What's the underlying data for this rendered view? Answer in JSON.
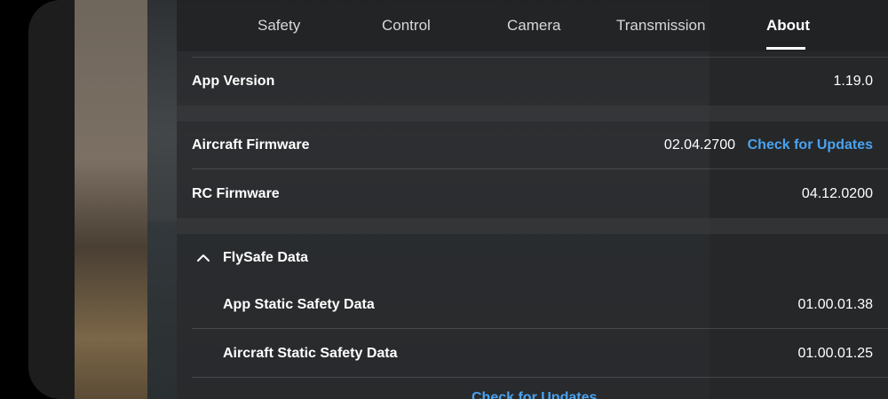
{
  "tabs": [
    {
      "label": "Safety",
      "active": false
    },
    {
      "label": "Control",
      "active": false
    },
    {
      "label": "Camera",
      "active": false
    },
    {
      "label": "Transmission",
      "active": false
    },
    {
      "label": "About",
      "active": true
    }
  ],
  "about": {
    "app_version": {
      "label": "App Version",
      "value": "1.19.0"
    },
    "aircraft_firmware": {
      "label": "Aircraft Firmware",
      "value": "02.04.2700",
      "action": "Check for Updates"
    },
    "rc_firmware": {
      "label": "RC Firmware",
      "value": "04.12.0200"
    },
    "flysafe": {
      "label": "FlySafe Data",
      "expanded": true,
      "items": [
        {
          "label": "App Static Safety Data",
          "value": "01.00.01.38"
        },
        {
          "label": "Aircraft Static Safety Data",
          "value": "01.00.01.25"
        }
      ],
      "action": "Check for Updates"
    }
  },
  "colors": {
    "accent_link": "#4aa3f0",
    "text": "#ffffff",
    "panel_bg": "#2a2c2e"
  }
}
